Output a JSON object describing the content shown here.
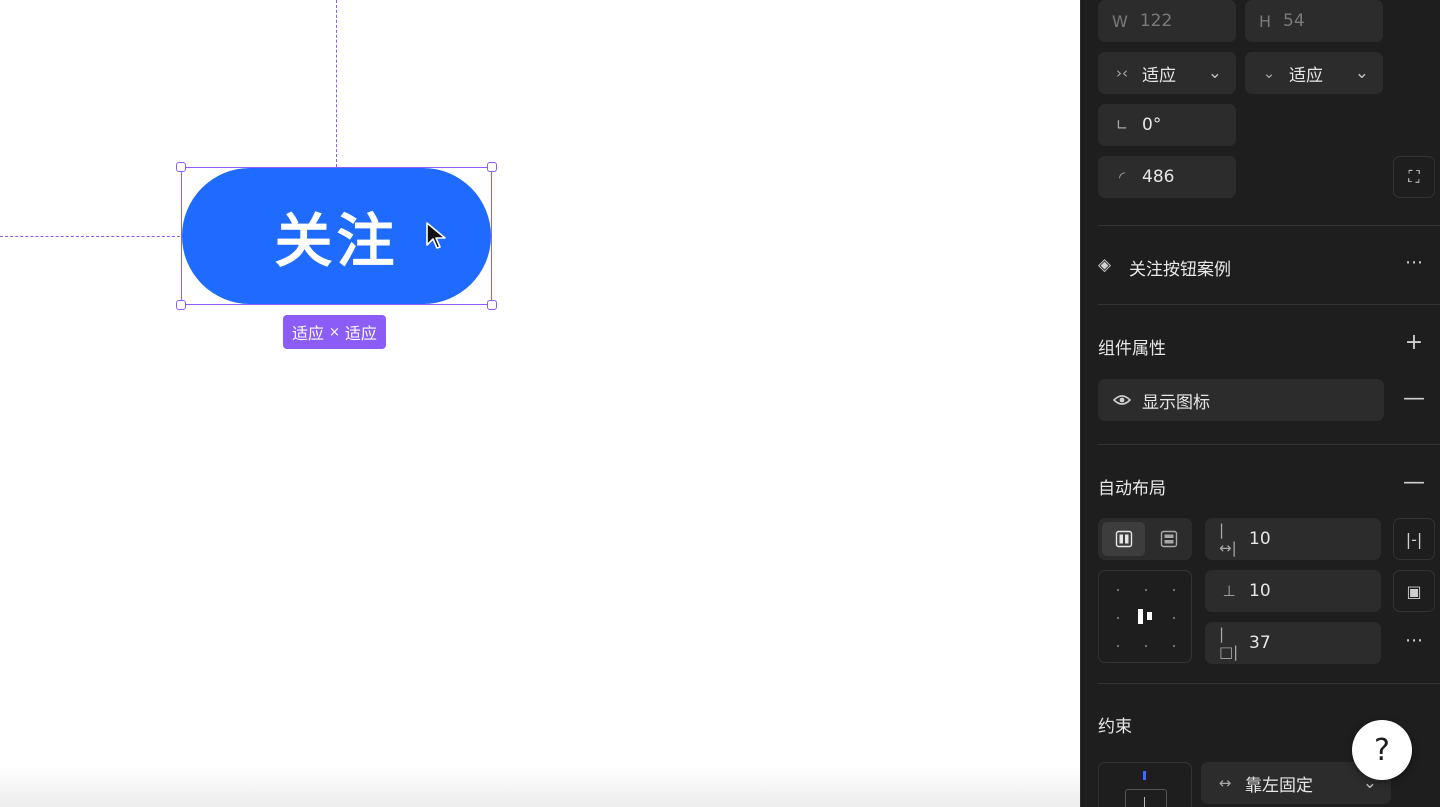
{
  "canvas": {
    "button_text": "关注",
    "size_tag": {
      "w": "适应",
      "sep": "×",
      "h": "适应"
    }
  },
  "panel": {
    "width": {
      "label": "W",
      "value": "122"
    },
    "height": {
      "label": "H",
      "value": "54"
    },
    "h_resize": "适应",
    "v_resize": "适应",
    "rotation": "0°",
    "radius": "486",
    "component_name": "关注按钮案例",
    "component_props_title": "组件属性",
    "prop_show_icon": "显示图标",
    "auto_layout_title": "自动布局",
    "gap_h": "10",
    "gap_v": "10",
    "padding": "37",
    "constraints_title": "约束",
    "constraint_h": "靠左固定"
  },
  "colors": {
    "accent": "#1f6bff",
    "selection": "#8b5cf6",
    "panel_bg": "#1e1e1e"
  }
}
